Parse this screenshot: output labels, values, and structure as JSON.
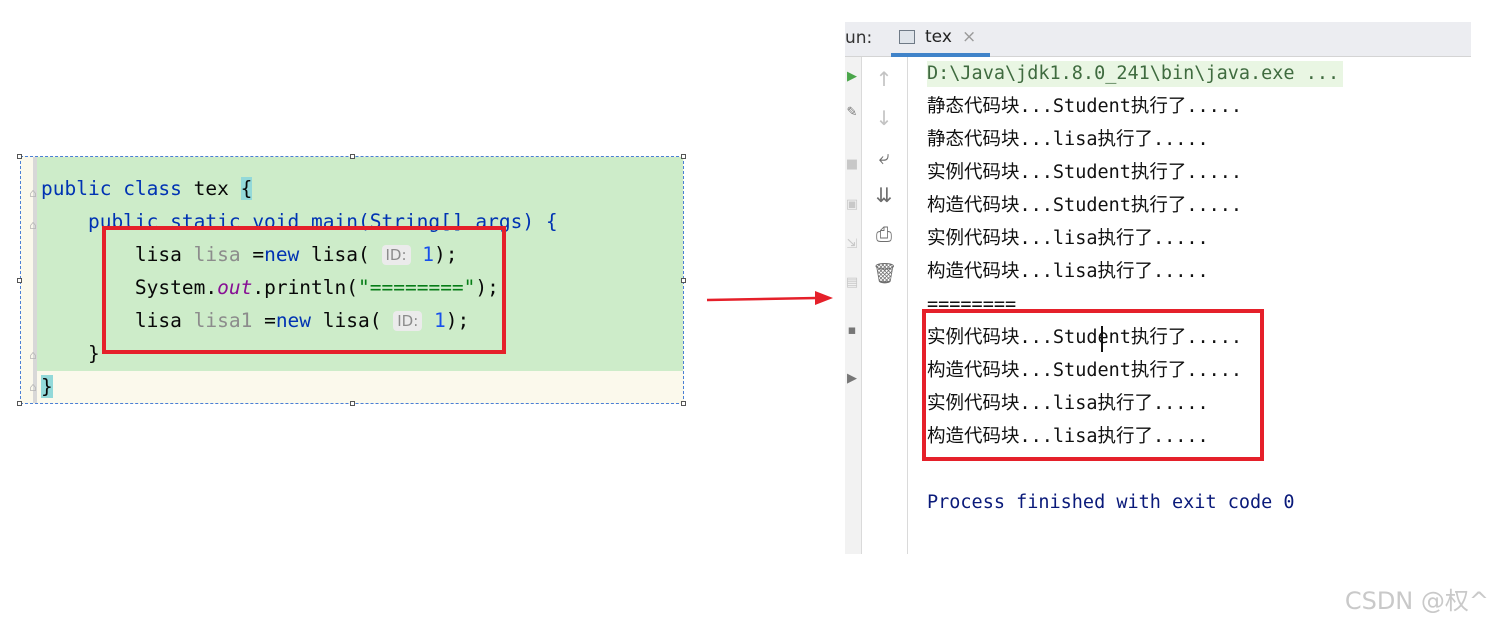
{
  "editor": {
    "lines": [
      {
        "parts": [
          {
            "t": "public ",
            "c": "kw"
          },
          {
            "t": "class ",
            "c": "kw"
          },
          {
            "t": "tex "
          },
          {
            "t": "{",
            "c": "brace-hl"
          }
        ]
      },
      {
        "parts": [
          {
            "t": "    public static void main(String[] args) {",
            "c": "kw"
          }
        ]
      },
      {
        "parts": [
          {
            "t": "        lisa "
          },
          {
            "t": "lisa",
            "c": "hint"
          },
          {
            "t": " ="
          },
          {
            "t": "new",
            "c": "kw"
          },
          {
            "t": " lisa( "
          },
          {
            "t": "ID:",
            "c": "param-hint"
          },
          {
            "t": " "
          },
          {
            "t": "1",
            "c": "num"
          },
          {
            "t": ");"
          }
        ]
      },
      {
        "parts": [
          {
            "t": "        System."
          },
          {
            "t": "out",
            "c": "field"
          },
          {
            "t": ".println("
          },
          {
            "t": "\"========\"",
            "c": "str"
          },
          {
            "t": ");"
          }
        ]
      },
      {
        "parts": [
          {
            "t": "        lisa "
          },
          {
            "t": "lisa1",
            "c": "hint"
          },
          {
            "t": " ="
          },
          {
            "t": "new",
            "c": "kw"
          },
          {
            "t": " lisa( "
          },
          {
            "t": "ID:",
            "c": "param-hint"
          },
          {
            "t": " "
          },
          {
            "t": "1",
            "c": "num"
          },
          {
            "t": ");"
          }
        ]
      },
      {
        "parts": [
          {
            "t": "    }"
          }
        ]
      },
      {
        "parts": [
          {
            "t": "}",
            "c": "brace-hl"
          }
        ]
      }
    ]
  },
  "run_panel": {
    "run_label": "un:",
    "tab_name": "tex",
    "tab_close": "×",
    "toolbar_icons": [
      "arrow-up-icon",
      "arrow-down-icon",
      "soft-wrap-icon",
      "scroll-to-end-icon",
      "print-icon",
      "trash-icon"
    ],
    "console_lines": [
      "D:\\Java\\jdk1.8.0_241\\bin\\java.exe ...",
      "静态代码块...Student执行了.....",
      "静态代码块...lisa执行了.....",
      "实例代码块...Student执行了.....",
      "构造代码块...Student执行了.....",
      "实例代码块...lisa执行了.....",
      "构造代码块...lisa执行了.....",
      "========",
      "实例代码块...Student执行了.....",
      "构造代码块...Student执行了.....",
      "实例代码块...lisa执行了.....",
      "构造代码块...lisa执行了.....",
      "",
      "Process finished with exit code 0"
    ]
  },
  "watermark": "CSDN @权^",
  "colors": {
    "highlight_box": "#e5202a",
    "arrow": "#e5202a",
    "selection": "#cdecc9",
    "tab_accent": "#4083c9"
  }
}
